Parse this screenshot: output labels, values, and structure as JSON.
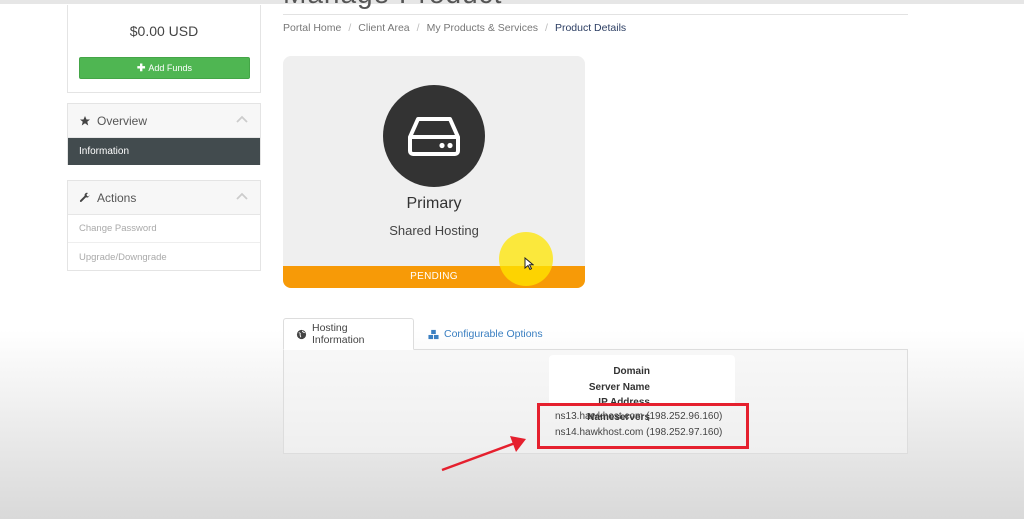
{
  "page": {
    "title": "Manage Product",
    "breadcrumb": [
      "Portal Home",
      "Client Area",
      "My Products & Services",
      "Product Details"
    ]
  },
  "sidebar": {
    "balance": "$0.00 USD",
    "add_funds_label": "Add Funds",
    "overview": {
      "title": "Overview",
      "items": [
        "Information"
      ]
    },
    "actions": {
      "title": "Actions",
      "items": [
        "Change Password",
        "Upgrade/Downgrade"
      ]
    }
  },
  "product": {
    "name": "Primary",
    "type": "Shared Hosting",
    "status": "PENDING"
  },
  "tabs": [
    {
      "label": "Hosting Information"
    },
    {
      "label": "Configurable Options"
    }
  ],
  "hosting_info": {
    "labels": {
      "domain": "Domain",
      "server_name": "Server Name",
      "ip_address": "IP Address",
      "nameservers": "Nameservers"
    },
    "nameservers": [
      "ns13.hawkhost.com (198.252.96.160)",
      "ns14.hawkhost.com (198.252.97.160)"
    ]
  },
  "colors": {
    "add_funds_green": "#4fb652",
    "status_orange": "#f79a07",
    "nav_active_bg": "#424b4e",
    "highlight_red": "#e5202e",
    "link_blue": "#3a7fc1"
  }
}
